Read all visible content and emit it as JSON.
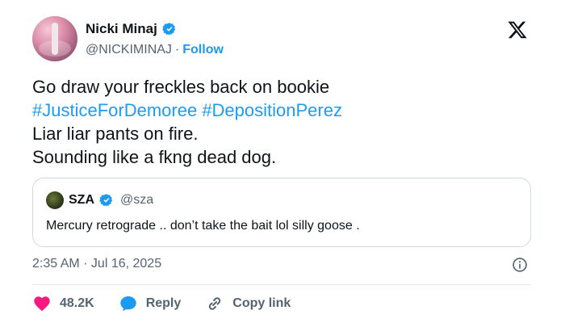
{
  "author": {
    "display_name": "Nicki Minaj",
    "handle": "@NICKIMINAJ",
    "separator": "·",
    "follow_label": "Follow",
    "verified": true
  },
  "tweet": {
    "line1": "Go draw your freckles back on bookie",
    "hashtag1": "#JusticeForDemoree",
    "hashtag2": "#DepositionPerez",
    "line3": "Liar liar pants on fire.",
    "line4": "Sounding like a fkng dead dog."
  },
  "quoted_tweet": {
    "display_name": "SZA",
    "handle": "@sza",
    "text": "Mercury retrograde .. don’t take the bait lol silly goose .",
    "verified": true
  },
  "meta": {
    "timestamp": "2:35 AM · Jul 16, 2025"
  },
  "actions": {
    "likes": "48.2K",
    "reply_label": "Reply",
    "copy_link_label": "Copy link"
  },
  "colors": {
    "accent": "#1d9bf0",
    "like": "#f91880",
    "text": "#0f1419",
    "secondary": "#536471",
    "border": "#cfd9de"
  },
  "icons": [
    "x-logo-icon",
    "verified-badge-icon",
    "info-icon",
    "heart-icon",
    "reply-bubble-icon",
    "link-icon"
  ]
}
